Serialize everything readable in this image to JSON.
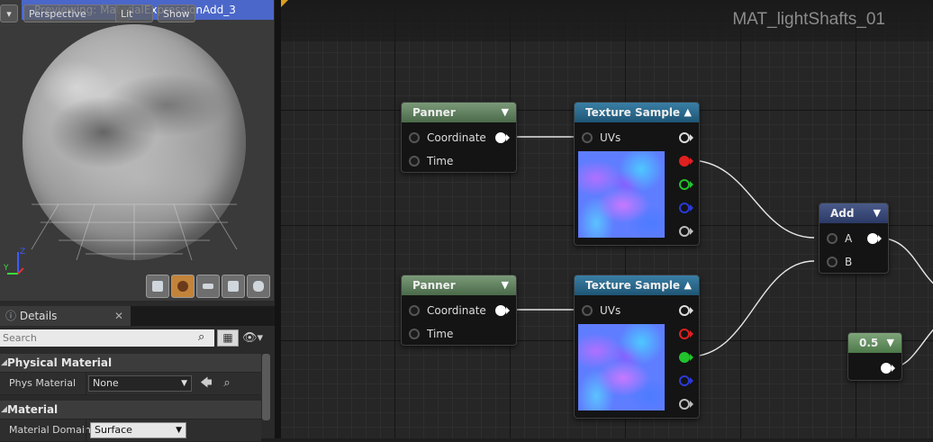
{
  "viewport": {
    "title": "Previewing: MaterialExpressionAdd_3",
    "buttons": {
      "menu": "▾",
      "perspective": "Perspective",
      "lit": "Lit",
      "show": "Show"
    },
    "tools": [
      "cylinder-icon",
      "sphere-icon",
      "plane-icon",
      "cube-icon",
      "teapot-icon"
    ]
  },
  "details": {
    "tab_label": "Details",
    "close": "✕",
    "search_placeholder": "Search",
    "sections": [
      {
        "title": "Physical Material",
        "props": [
          {
            "label": "Phys Material",
            "value": "None"
          }
        ]
      },
      {
        "title": "Material",
        "props": [
          {
            "label": "Material Domain",
            "value": "Surface"
          }
        ]
      }
    ]
  },
  "graph": {
    "title": "MAT_lightShafts_01",
    "nodes": {
      "panner1": {
        "title": "Panner",
        "pins": [
          "Coordinate",
          "Time"
        ]
      },
      "panner2": {
        "title": "Panner",
        "pins": [
          "Coordinate",
          "Time"
        ]
      },
      "tex1": {
        "title": "Texture Sample",
        "pins": [
          "UVs"
        ]
      },
      "tex2": {
        "title": "Texture Sample",
        "pins": [
          "UVs"
        ]
      },
      "add": {
        "title": "Add",
        "pins": [
          "A",
          "B"
        ]
      },
      "const": {
        "title": "0.5"
      }
    }
  },
  "colors": {
    "viewport_title_bar": "#4b67c9",
    "panner_header": "#5e7f5c",
    "texture_header": "#2b6b90",
    "add_header": "#3a4a78",
    "const_header": "#5e8a5a",
    "pin_red": "#e02020",
    "pin_green": "#22c22c",
    "pin_blue": "#2b3ad8"
  }
}
